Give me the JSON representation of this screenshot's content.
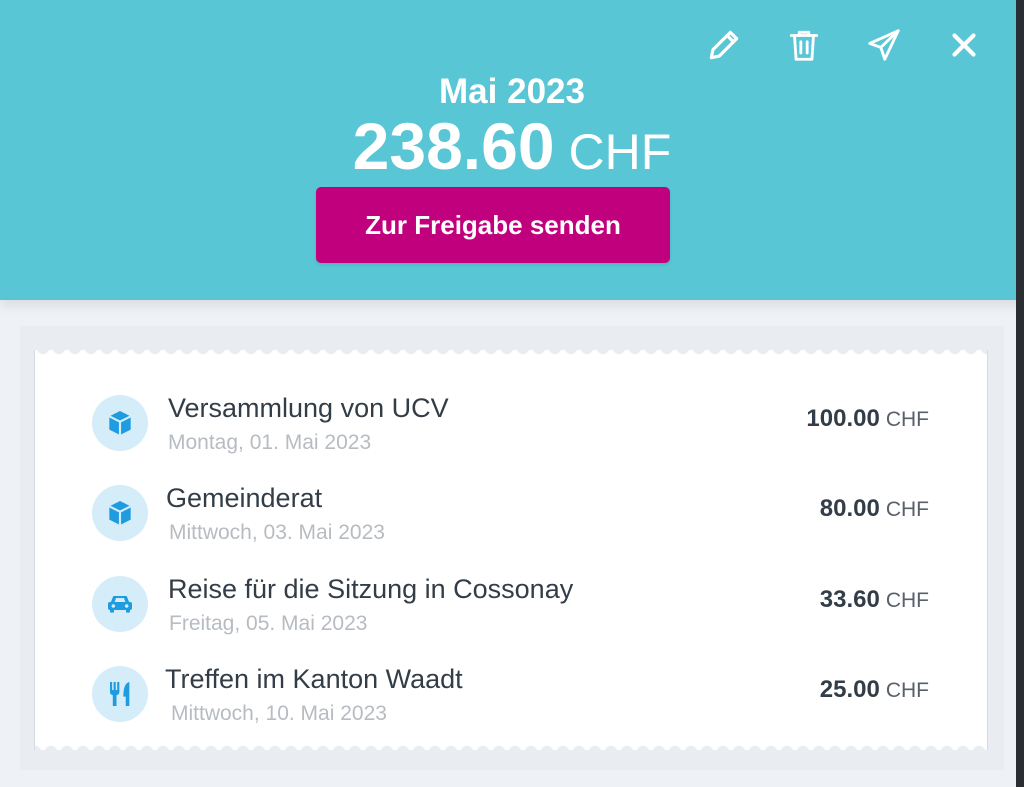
{
  "header": {
    "period": "Mai 2023",
    "total_amount": "238.60",
    "total_currency": "CHF",
    "submit_label": "Zur Freigabe senden",
    "toolbar": [
      "pencil-icon",
      "trash-icon",
      "send-icon",
      "close-icon"
    ]
  },
  "expenses": [
    {
      "title": "Versammlung von UCV",
      "date": "Montag, 01. Mai 2023",
      "amount": "100.00",
      "currency": "CHF",
      "icon": "box-icon"
    },
    {
      "title": "Gemeinderat",
      "date": "Mittwoch, 03. Mai 2023",
      "amount": "80.00",
      "currency": "CHF",
      "icon": "box-icon"
    },
    {
      "title": "Reise für die Sitzung in Cossonay",
      "date": "Freitag, 05. Mai 2023",
      "amount": "33.60",
      "currency": "CHF",
      "icon": "car-icon"
    },
    {
      "title": "Treffen im Kanton Waadt",
      "date": "Mittwoch, 10. Mai 2023",
      "amount": "25.00",
      "currency": "CHF",
      "icon": "fork-knife-icon"
    }
  ],
  "colors": {
    "header_bg": "#59c6d5",
    "accent_button": "#c1007d",
    "icon_blue": "#1f9be0",
    "icon_bg": "#d4edf9"
  }
}
